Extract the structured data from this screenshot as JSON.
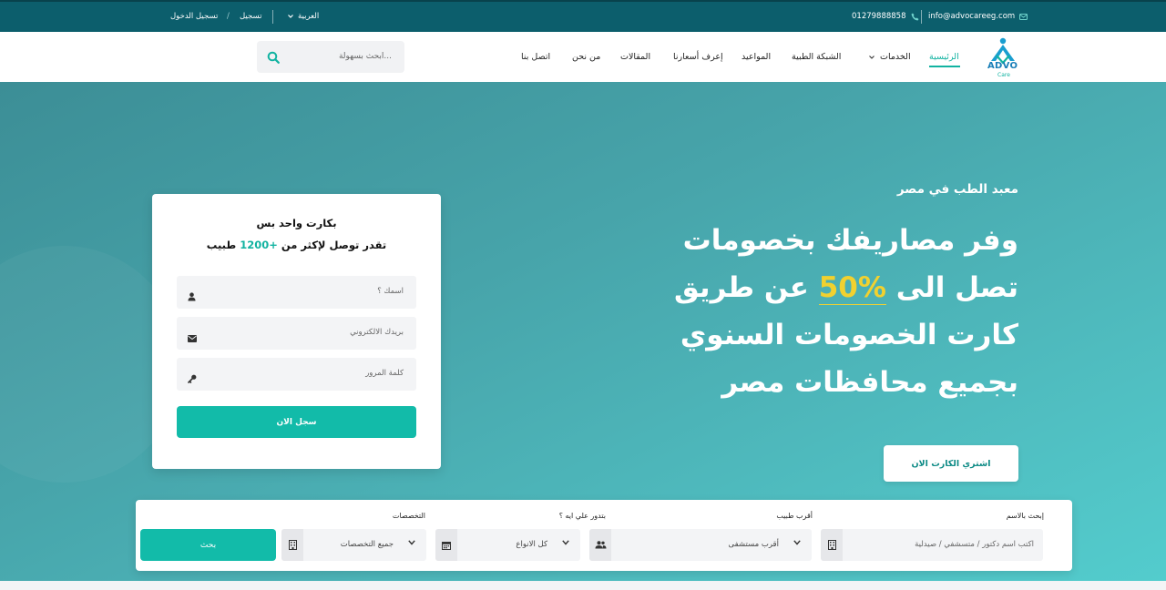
{
  "topbar": {
    "email": "info@advocareeg.com",
    "phone": "01279888858",
    "language": "العربية",
    "register": "تسجيل",
    "divider": "/",
    "login": "تسجيل الدخول"
  },
  "header": {
    "logo_text": "ADVO",
    "logo_sub": "Care",
    "nav": [
      {
        "label": "الرئيسية",
        "active": true
      },
      {
        "label": "الخدمات",
        "has_dropdown": true
      },
      {
        "label": "الشبكة الطبية"
      },
      {
        "label": "المواعيد"
      },
      {
        "label": "إعرف أسعارنا"
      },
      {
        "label": "المقالات"
      },
      {
        "label": "من نحن"
      },
      {
        "label": "اتصل بنا"
      }
    ],
    "search_placeholder": "ابحث بسهولة..."
  },
  "hero": {
    "subtitle": "معبد الطب في مصر",
    "title_line1": "وفر مصاريفك بخصومات",
    "title_line2_before": "تصل الى",
    "title_highlight": "50%",
    "title_line2_after": "عن طريق",
    "title_line3": "كارت الخصومات السنوي",
    "title_line4": "بجميع محافظات مصر",
    "buy_button": "اشتري الكارت الان"
  },
  "register_card": {
    "line1": "بكارت واحد بس",
    "line2_before": "تقدر توصل لإكثر من",
    "line2_accent": "1200+",
    "line2_after": "طبيب",
    "name_placeholder": "اسمك ؟",
    "email_placeholder": "بريدك الالكتروني",
    "password_placeholder": "كلمة المرور",
    "submit": "سجل الان"
  },
  "search_panel": {
    "name_label": "إبحث بالاسم",
    "name_placeholder": "اكتب اسم دكتور / متسشفي / صيدلية",
    "nearest_label": "أقرب طبيب",
    "nearest_value": "أقرب مستشفى",
    "type_label": "بتدور علي ايه ؟",
    "type_value": "كل الانواع",
    "spec_label": "التخصصات",
    "spec_value": "جميع التخصصات",
    "search_button": "بحث"
  },
  "colors": {
    "topbar": "#0c5e6c",
    "accent": "#12bba9",
    "highlight": "#f1d12f"
  }
}
